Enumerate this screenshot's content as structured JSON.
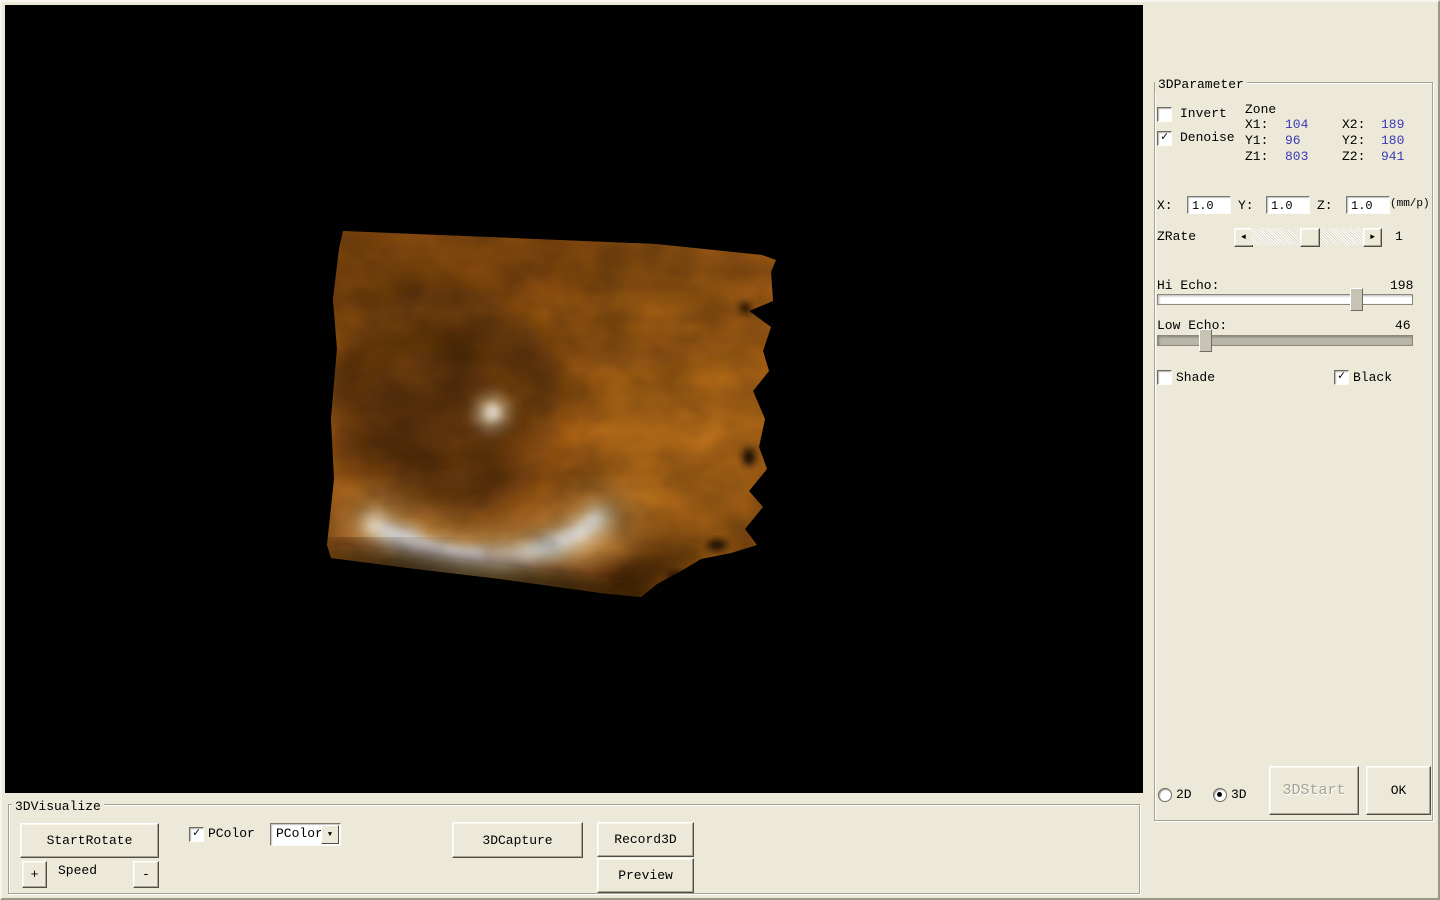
{
  "colors": {
    "window_bg": "#ece9d8",
    "value_text": "#3a3ab8",
    "disabled_text": "#a5a293",
    "viewport_bg": "#010101",
    "render_base": "#a85f16",
    "render_dark": "#5c3107",
    "render_bright": "#fff6e0"
  },
  "icons": {
    "check": "✓",
    "arrow_left": "◄",
    "arrow_right": "►",
    "arrow_down": "▼"
  },
  "parameter_panel": {
    "title": "3DParameter",
    "invert_label": "Invert",
    "denoise_label": "Denoise",
    "zone": {
      "title": "Zone",
      "x1_label": "X1:",
      "x1": "104",
      "x2_label": "X2:",
      "x2": "189",
      "y1_label": "Y1:",
      "y1": "96",
      "y2_label": "Y2:",
      "y2": "180",
      "z1_label": "Z1:",
      "z1": "803",
      "z2_label": "Z2:",
      "z2": "941"
    },
    "scale": {
      "x_label": "X:",
      "x": "1.0",
      "y_label": "Y:",
      "y": "1.0",
      "z_label": "Z:",
      "z": "1.0",
      "unit": "(mm/p)"
    },
    "zrate": {
      "label": "ZRate",
      "value": "1"
    },
    "hi_echo": {
      "label": "Hi Echo:",
      "value": "198"
    },
    "low_echo": {
      "label": "Low Echo:",
      "value": "46"
    },
    "shade_label": "Shade",
    "black_label": "Black",
    "mode_2d": "2D",
    "mode_3d": "3D",
    "start3d_label": "3DStart",
    "ok_label": "OK"
  },
  "visualize_panel": {
    "title": "3DVisualize",
    "start_rotate_label": "StartRotate",
    "pcolor_checkbox_label": "PColor",
    "pcolor_selected": "PColor",
    "capture_label": "3DCapture",
    "record_label": "Record3D",
    "preview_label": "Preview",
    "speed_plus_label": "+",
    "speed_label": "Speed",
    "speed_minus_label": "-"
  }
}
